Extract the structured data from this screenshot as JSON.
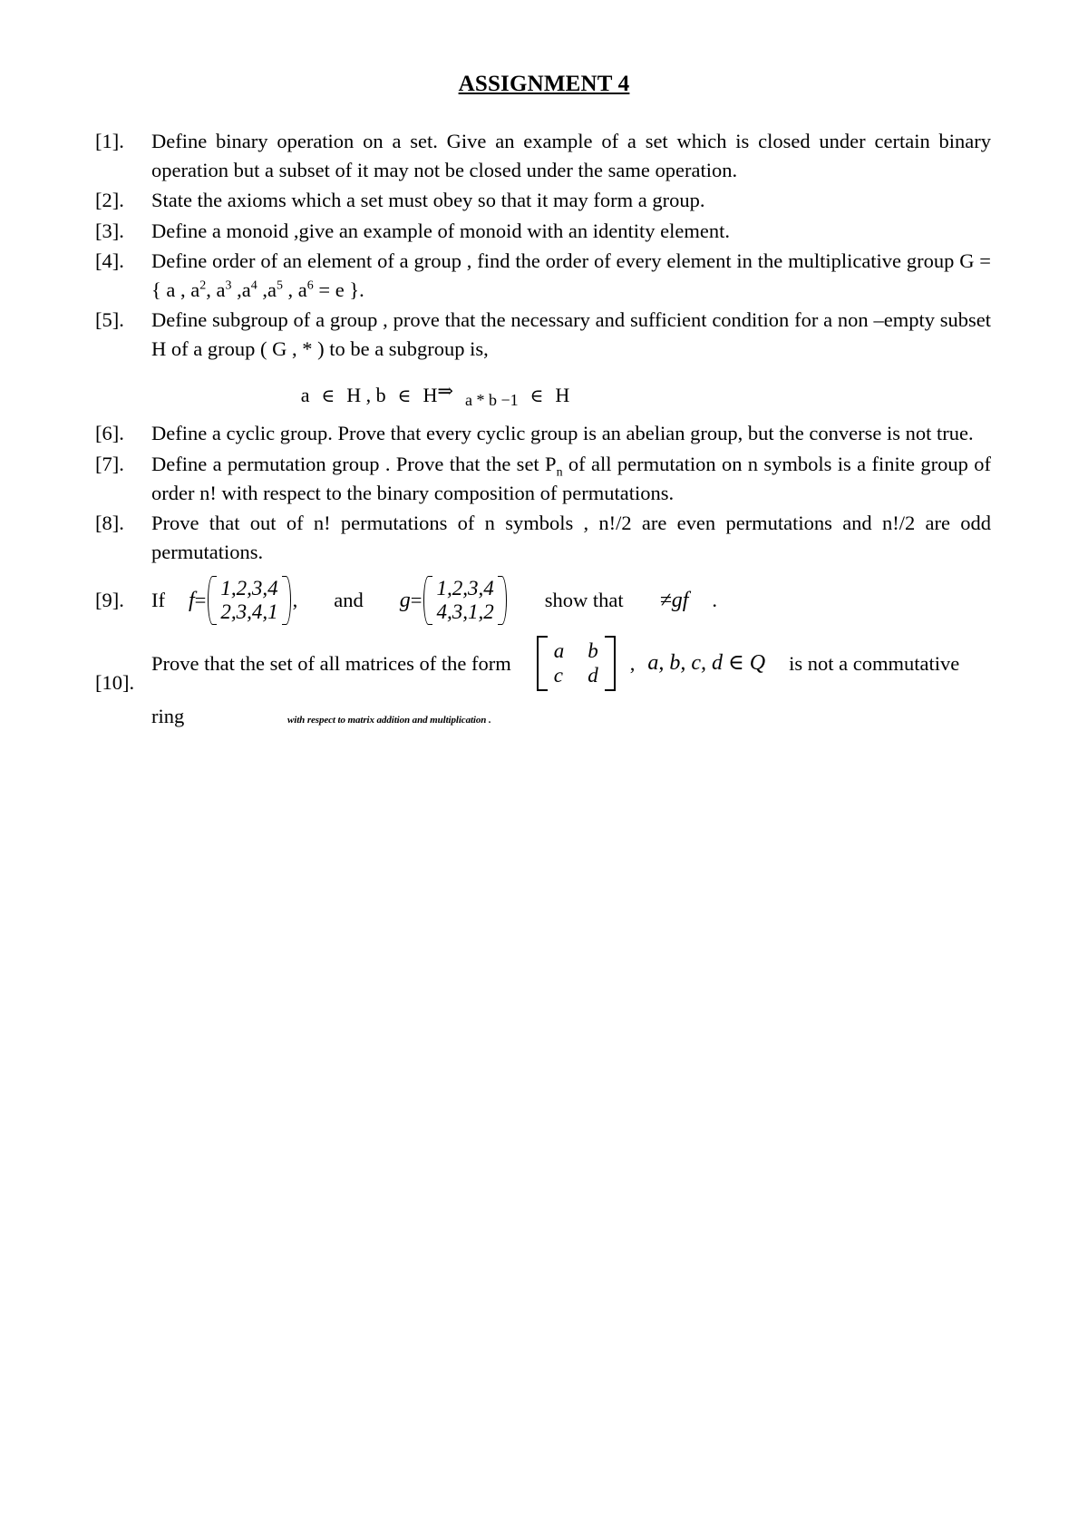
{
  "document": {
    "title": "ASSIGNMENT 4",
    "questions": [
      {
        "number": "[1].",
        "text": "Define binary operation on a set.  Give an example of a set which is closed under certain binary operation but a subset of it may not be  closed under the same operation."
      },
      {
        "number": "[2].",
        "text": "State the axioms which a set must obey so that it may form a group."
      },
      {
        "number": "[3].",
        "text": "Define a monoid ,give an example of monoid with an identity element."
      },
      {
        "number": "[4].",
        "text_part1": "Define order of  an element of a group , find the order of every element in the multiplicative group G = { a , a",
        "sup1": "2",
        "text_part2": ", a",
        "sup2": "3",
        "text_part3": " ,a",
        "sup3": "4",
        "text_part4": " ,a",
        "sup4": "5",
        "text_part5": " , a",
        "sup5": "6",
        "text_part6": " = e }."
      },
      {
        "number": "[5].",
        "text": "Define subgroup of a group , prove  that the necessary and sufficient condition  for a non –empty subset  H of a group ( G , * ) to be a subgroup is,",
        "equation": {
          "a": "a",
          "in1": "∈",
          "H1": "H , b",
          "in2": "∈",
          "H2": "H",
          "implies": "⇒",
          "rhs": "a * b −1",
          "in3": "∈",
          "H3": "H"
        }
      },
      {
        "number": "[6].",
        "text": "Define a cyclic group. Prove that every cyclic group is an abelian group, but the converse is not true."
      },
      {
        "number": "[7].",
        "text_part1": "Define a permutation group . Prove that the set P",
        "sub1": "n",
        "text_part2": " of all permutation on n symbols  is a finite group of order n! with respect to the binary composition of permutations."
      },
      {
        "number": "[8].",
        "text": "Prove that out of n! permutations of n symbols , n!/2 are even permutations and n!/2 are odd permutations."
      },
      {
        "number": "[9].",
        "if_label": "If",
        "f_symbol": "f",
        "equals": "=",
        "f_top": "1,2,3,4",
        "f_bottom": "2,3,4,1",
        "comma": ",",
        "and_label": "and",
        "g_symbol": "g",
        "g_top": "1,2,3,4",
        "g_bottom": "4,3,1,2",
        "show_label": "show that",
        "conclusion": "≠gf",
        "period": "."
      },
      {
        "number": "[10].",
        "text_part1": "Prove that the set of all matrices of the form",
        "matrix_row1_col1": "a",
        "matrix_row1_col2": "b",
        "matrix_row2_col1": "c",
        "matrix_row2_col2": "d",
        "text_part2": ",",
        "condition": "a, b, c, d ∈ Q",
        "text_part3": "is not a commutative",
        "text_part4": "ring",
        "footnote": "with respect to matrix addition and multiplication ."
      }
    ]
  }
}
